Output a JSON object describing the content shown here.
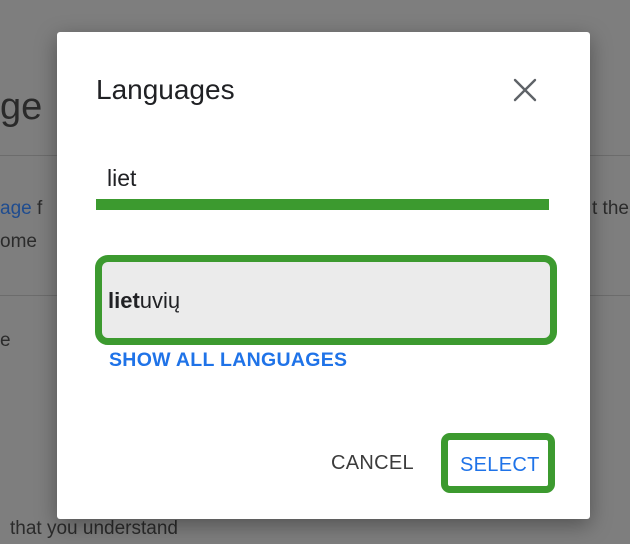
{
  "background": {
    "title_fragment": "ge",
    "line1_link": "age",
    "line1_rest": " f",
    "line2_fragment": "ome",
    "line3_fragment": "e",
    "right_fragment": "t the",
    "bottom_text": "that you understand"
  },
  "dialog": {
    "title": "Languages",
    "close_icon": "close-icon",
    "search": {
      "value": "liet",
      "placeholder": ""
    },
    "options": [
      {
        "match": "liet",
        "rest": "uvių",
        "full": "lietuvių"
      }
    ],
    "show_all_label": "SHOW ALL LANGUAGES",
    "cancel_label": "CANCEL",
    "select_label": "SELECT"
  },
  "colors": {
    "accent": "#1f73e8",
    "highlight_outline": "#3c9a2f",
    "overlay": "#7e7e7e"
  }
}
